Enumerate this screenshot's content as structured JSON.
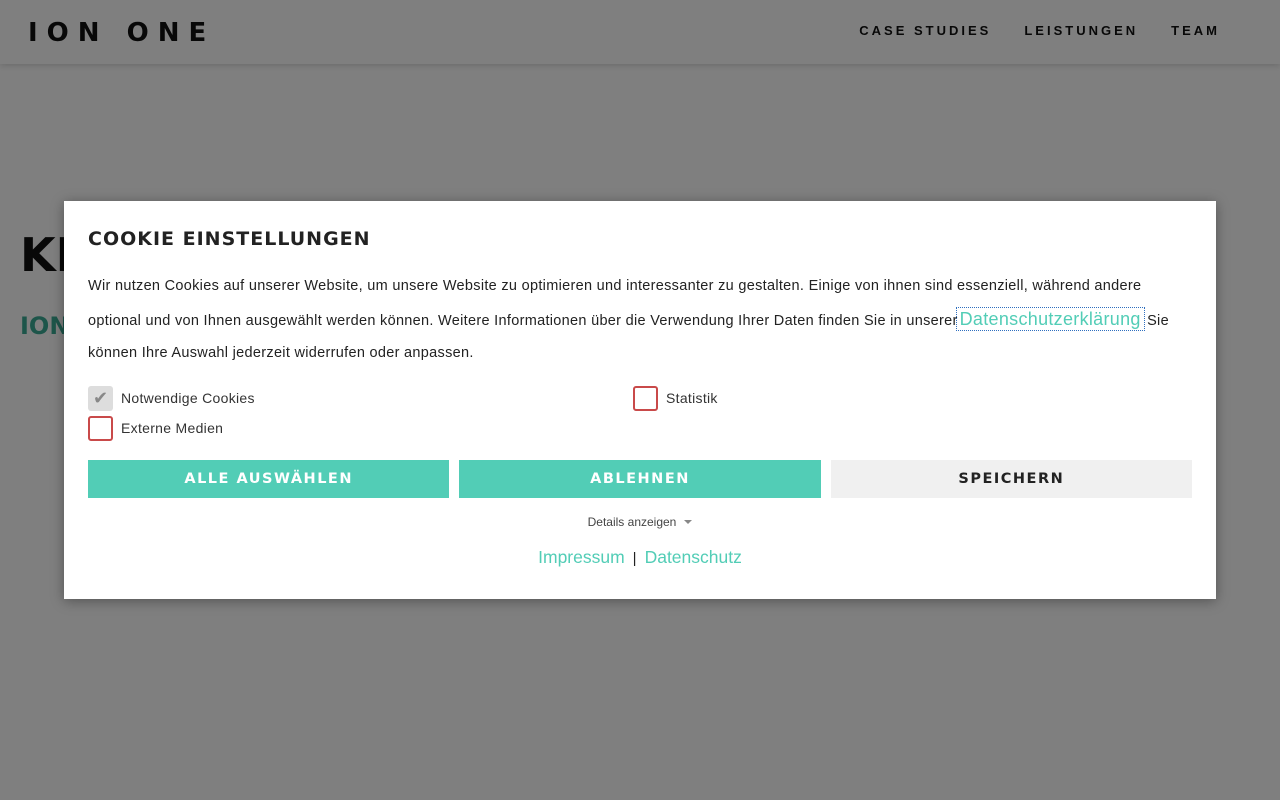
{
  "header": {
    "logo": "ION ONE",
    "nav": [
      "CASE STUDIES",
      "LEISTUNGEN",
      "TEAM"
    ]
  },
  "background": {
    "heading": "KI",
    "subheading": "ION"
  },
  "cookie_modal": {
    "title": "COOKIE EINSTELLUNGEN",
    "text_before_link": "Wir nutzen Cookies auf unserer Website, um unsere Website zu optimieren und interessanter zu gestalten. Einige von ihnen sind essenziell, während andere optional und von Ihnen ausgewählt werden können. Weitere Informationen über die Verwendung Ihrer Daten finden Sie in unserer",
    "link_label": "Datenschutzerklärung",
    "text_after_link": "Sie können Ihre Auswahl jederzeit widerrufen oder anpassen.",
    "checkboxes": {
      "necessary": {
        "label": "Notwendige Cookies",
        "checked": true
      },
      "statistics": {
        "label": "Statistik",
        "checked": false
      },
      "external": {
        "label": "Externe Medien",
        "checked": false
      }
    },
    "buttons": {
      "select_all": "ALLE AUSWÄHLEN",
      "decline": "ABLEHNEN",
      "save": "SPEICHERN"
    },
    "details_label": "Details anzeigen",
    "footer": {
      "imprint": "Impressum",
      "separator": "|",
      "privacy": "Datenschutz"
    }
  },
  "colors": {
    "accent": "#52cdb6",
    "checkbox_border": "#c94a4a"
  }
}
